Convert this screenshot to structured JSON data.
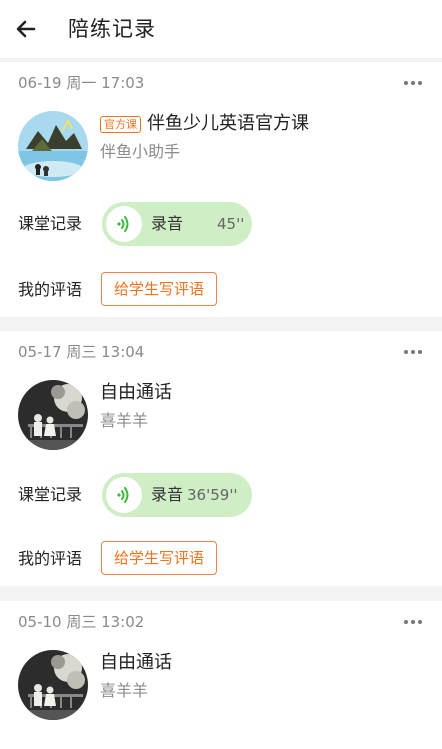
{
  "header": {
    "title": "陪练记录"
  },
  "records": [
    {
      "date": "06-19 周一 17:03",
      "tag": "官方课",
      "name": "伴鱼少儿英语官方课",
      "teacher": "伴鱼小助手",
      "class_record_label": "课堂记录",
      "audio_label": "录音",
      "audio_duration": "45''",
      "comment_label": "我的评语",
      "comment_button": "给学生写评语"
    },
    {
      "date": "05-17 周三 13:04",
      "name": "自由通话",
      "teacher": "喜羊羊",
      "class_record_label": "课堂记录",
      "audio_label": "录音",
      "audio_duration": "36'59''",
      "comment_label": "我的评语",
      "comment_button": "给学生写评语"
    },
    {
      "date": "05-10 周三 13:02",
      "name": "自由通话",
      "teacher": "喜羊羊"
    }
  ],
  "colors": {
    "accent_orange": "#f0731f",
    "audio_bg": "#cfeec6",
    "audio_icon_green": "#3cb83c"
  },
  "icons": [
    "back-arrow-icon",
    "more-icon",
    "sound-wave-icon"
  ]
}
